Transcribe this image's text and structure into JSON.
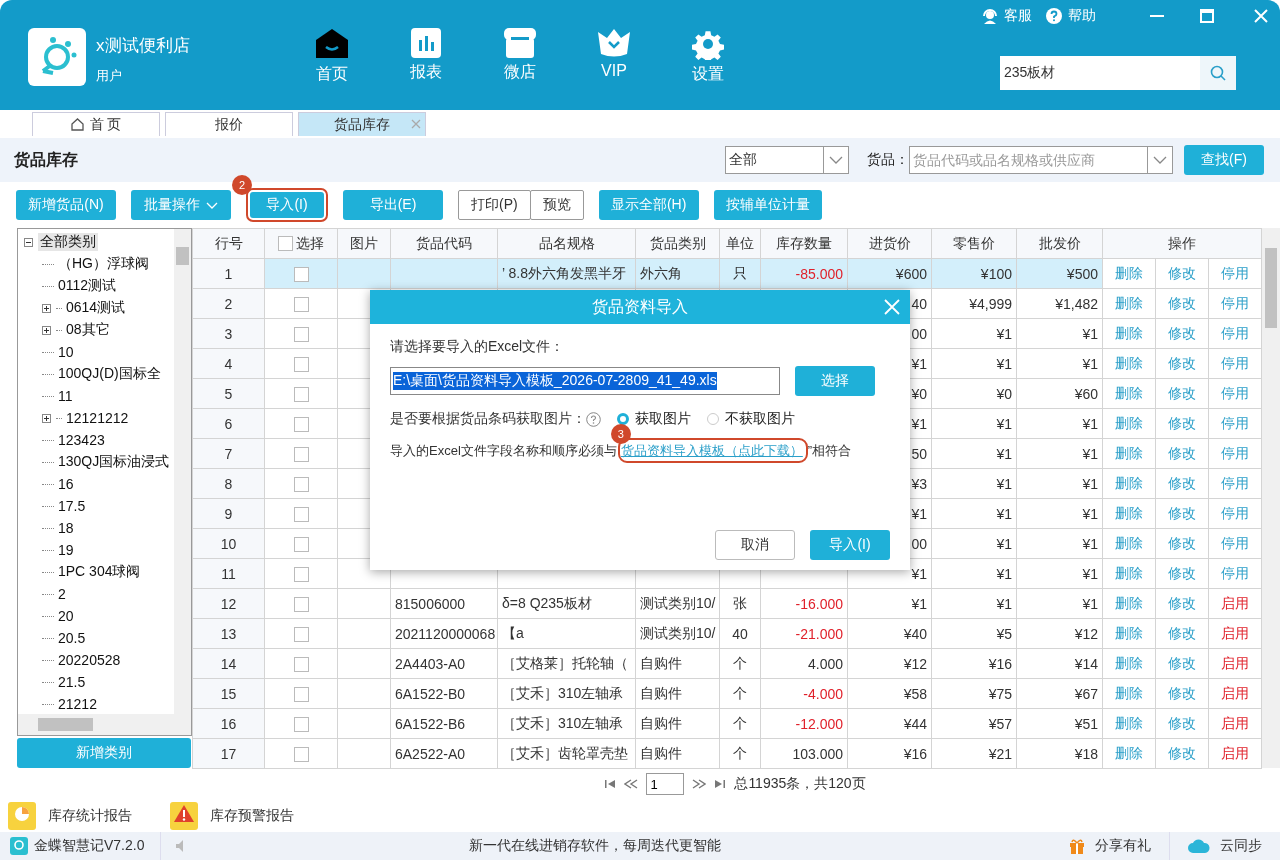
{
  "window": {
    "store_name": "x测试便利店",
    "user": "用户",
    "top_links": [
      {
        "kind": "service",
        "label": "客服"
      },
      {
        "kind": "help",
        "label": "帮助"
      }
    ]
  },
  "nav": [
    {
      "kind": "home",
      "label": "首页"
    },
    {
      "kind": "report",
      "label": "报表"
    },
    {
      "kind": "shop",
      "label": "微店"
    },
    {
      "kind": "vip",
      "label": "VIP"
    },
    {
      "kind": "settings",
      "label": "设置"
    }
  ],
  "search": {
    "value": "235板材"
  },
  "tabs": [
    {
      "kind": "home",
      "label": "首 页",
      "selected": false,
      "closable": false
    },
    {
      "kind": "plain",
      "label": "报价",
      "selected": false,
      "closable": false
    },
    {
      "kind": "plain",
      "label": "货品库存",
      "selected": true,
      "closable": true
    }
  ],
  "page": {
    "title": "货品库存",
    "filter": "全部",
    "goods_label": "货品：",
    "goods_placeholder": "货品代码或品名规格或供应商",
    "find_button": "查找(F)"
  },
  "toolbar": [
    {
      "kind": "button",
      "label": "新增货品(N)"
    },
    {
      "kind": "menu",
      "label": "批量操作"
    },
    {
      "kind": "button",
      "label": "导入(I)",
      "callout": "2"
    },
    {
      "kind": "button",
      "label": "导出(E)"
    },
    {
      "kind": "outline",
      "label": "打印(P)"
    },
    {
      "kind": "outline",
      "label": "预览"
    },
    {
      "kind": "button",
      "label": "显示全部(H)"
    },
    {
      "kind": "button",
      "label": "按辅单位计量"
    }
  ],
  "tree": {
    "add_button": "新增类别",
    "items": [
      {
        "label": "全部类别",
        "selected": true,
        "expanded": true,
        "children": [
          {
            "label": "（HG）浮球阀",
            "selected": false
          },
          {
            "label": "0112测试",
            "selected": false
          },
          {
            "label": "0614测试",
            "selected": false,
            "expanded": false
          },
          {
            "label": "08其它",
            "selected": false,
            "expanded": false
          },
          {
            "label": "10",
            "selected": false
          },
          {
            "label": "100QJ(D)国标全",
            "selected": false
          },
          {
            "label": "11",
            "selected": false
          },
          {
            "label": "12121212",
            "selected": false,
            "expanded": false
          },
          {
            "label": "123423",
            "selected": false
          },
          {
            "label": "130QJ国标油浸式",
            "selected": false
          },
          {
            "label": "16",
            "selected": false
          },
          {
            "label": "17.5",
            "selected": false
          },
          {
            "label": "18",
            "selected": false
          },
          {
            "label": "19",
            "selected": false
          },
          {
            "label": "1PC 304球阀",
            "selected": false
          },
          {
            "label": "2",
            "selected": false
          },
          {
            "label": "20",
            "selected": false
          },
          {
            "label": "20.5",
            "selected": false
          },
          {
            "label": "20220528",
            "selected": false
          },
          {
            "label": "21.5",
            "selected": false
          },
          {
            "label": "21212",
            "selected": false
          }
        ]
      }
    ]
  },
  "table": {
    "columns": [
      "行号",
      "选择",
      "图片",
      "货品代码",
      "品名规格",
      "货品类别",
      "单位",
      "库存数量",
      "进货价",
      "零售价",
      "批发价",
      "操作"
    ],
    "select_all_checked": false,
    "rows": [
      {
        "no": "1",
        "selected": true,
        "checked": false,
        "name": "’ 8.8外六角发黑半牙",
        "category": "外六角",
        "unit": "只",
        "stock": "-85.000",
        "stock_alert": true,
        "cost": "¥600",
        "retail": "¥100",
        "wholesale": "¥500",
        "actions": [
          "删除",
          "修改",
          "停用"
        ],
        "enabled": true
      },
      {
        "no": "2",
        "selected": false,
        "checked": false,
        "cost": "40",
        "retail": "¥4,999",
        "wholesale": "¥1,482",
        "actions": [
          "删除",
          "修改",
          "停用"
        ],
        "enabled": true
      },
      {
        "no": "3",
        "selected": false,
        "checked": false,
        "cost": "00",
        "retail": "¥1",
        "wholesale": "¥1",
        "actions": [
          "删除",
          "修改",
          "停用"
        ],
        "enabled": true
      },
      {
        "no": "4",
        "selected": false,
        "checked": false,
        "cost": "¥1",
        "retail": "¥1",
        "wholesale": "¥1",
        "actions": [
          "删除",
          "修改",
          "停用"
        ],
        "enabled": true
      },
      {
        "no": "5",
        "selected": false,
        "checked": false,
        "cost": "¥0",
        "retail": "¥0",
        "wholesale": "¥60",
        "actions": [
          "删除",
          "修改",
          "停用"
        ],
        "enabled": true
      },
      {
        "no": "6",
        "selected": false,
        "checked": false,
        "cost": "¥1",
        "retail": "¥1",
        "wholesale": "¥1",
        "actions": [
          "删除",
          "修改",
          "停用"
        ],
        "enabled": true
      },
      {
        "no": "7",
        "selected": false,
        "checked": false,
        "cost": "50",
        "retail": "¥1",
        "wholesale": "¥1",
        "actions": [
          "删除",
          "修改",
          "停用"
        ],
        "enabled": true
      },
      {
        "no": "8",
        "selected": false,
        "checked": false,
        "cost": "¥3",
        "retail": "¥1",
        "wholesale": "¥1",
        "actions": [
          "删除",
          "修改",
          "停用"
        ],
        "enabled": true
      },
      {
        "no": "9",
        "selected": false,
        "checked": false,
        "cost": "¥1",
        "retail": "¥1",
        "wholesale": "¥1",
        "actions": [
          "删除",
          "修改",
          "停用"
        ],
        "enabled": true
      },
      {
        "no": "10",
        "selected": false,
        "checked": false,
        "cost": "00",
        "retail": "¥1",
        "wholesale": "¥1",
        "actions": [
          "删除",
          "修改",
          "停用"
        ],
        "enabled": true
      },
      {
        "no": "11",
        "selected": false,
        "checked": false,
        "cost": "¥1",
        "retail": "¥1",
        "wholesale": "¥1",
        "actions": [
          "删除",
          "修改",
          "停用"
        ],
        "enabled": true
      },
      {
        "no": "12",
        "selected": false,
        "checked": false,
        "code": "815006000",
        "name": "δ=8 Q235板材",
        "category": "测试类别10/",
        "unit": "张",
        "stock": "-16.000",
        "stock_alert": true,
        "cost": "¥1",
        "retail": "¥1",
        "wholesale": "¥1",
        "actions": [
          "删除",
          "修改",
          "启用"
        ],
        "enabled": false
      },
      {
        "no": "13",
        "selected": false,
        "checked": false,
        "code": "2021120000068",
        "name": "【a",
        "category": "测试类别10/",
        "unit": "40",
        "stock": "-21.000",
        "stock_alert": true,
        "cost": "¥40",
        "retail": "¥5",
        "wholesale": "¥12",
        "actions": [
          "删除",
          "修改",
          "启用"
        ],
        "enabled": false
      },
      {
        "no": "14",
        "selected": false,
        "checked": false,
        "code": "2A4403-A0",
        "name": "［艾格莱］托轮轴（",
        "category": "自购件",
        "unit": "个",
        "stock": "4.000",
        "stock_alert": false,
        "cost": "¥12",
        "retail": "¥16",
        "wholesale": "¥14",
        "actions": [
          "删除",
          "修改",
          "启用"
        ],
        "enabled": false
      },
      {
        "no": "15",
        "selected": false,
        "checked": false,
        "code": "6A1522-B0",
        "name": "［艾禾］310左轴承",
        "category": "自购件",
        "unit": "个",
        "stock": "-4.000",
        "stock_alert": true,
        "cost": "¥58",
        "retail": "¥75",
        "wholesale": "¥67",
        "actions": [
          "删除",
          "修改",
          "启用"
        ],
        "enabled": false
      },
      {
        "no": "16",
        "selected": false,
        "checked": false,
        "code": "6A1522-B6",
        "name": "［艾禾］310左轴承",
        "category": "自购件",
        "unit": "个",
        "stock": "-12.000",
        "stock_alert": true,
        "cost": "¥44",
        "retail": "¥57",
        "wholesale": "¥51",
        "actions": [
          "删除",
          "修改",
          "启用"
        ],
        "enabled": false
      },
      {
        "no": "17",
        "selected": false,
        "checked": false,
        "code": "6A2522-A0",
        "name": "［艾禾］齿轮罩壳垫",
        "category": "自购件",
        "unit": "个",
        "stock": "103.000",
        "stock_alert": false,
        "cost": "¥16",
        "retail": "¥21",
        "wholesale": "¥18",
        "actions": [
          "删除",
          "修改",
          "启用"
        ],
        "enabled": false
      }
    ]
  },
  "pagination": {
    "page": "1",
    "summary": "总11935条，共120页"
  },
  "reports": [
    {
      "kind": "stats",
      "label": "库存统计报告"
    },
    {
      "kind": "warning",
      "label": "库存预警报告"
    }
  ],
  "status_bar": {
    "version": "金蝶智慧记V7.2.0",
    "message": "新一代在线进销存软件，每周迭代更智能",
    "share": "分享有礼",
    "sync": "云同步"
  },
  "dialog": {
    "title": "货品资料导入",
    "file_label": "请选择要导入的Excel文件：",
    "file_value": "E:\\桌面\\货品资料导入模板_2026-07-2809_41_49.xls",
    "choose_button": "选择",
    "image_label": "是否要根据货品条码获取图片：",
    "image_options": [
      {
        "label": "获取图片",
        "selected": true
      },
      {
        "label": "不获取图片",
        "selected": false
      }
    ],
    "note_before": "导入的Excel文件字段名称和顺序必须与",
    "template_link": "货品资料导入模板（点此下载）",
    "template_callout": "3",
    "note_after": "”相符合",
    "cancel_button": "取消",
    "import_button": "导入(I)"
  }
}
